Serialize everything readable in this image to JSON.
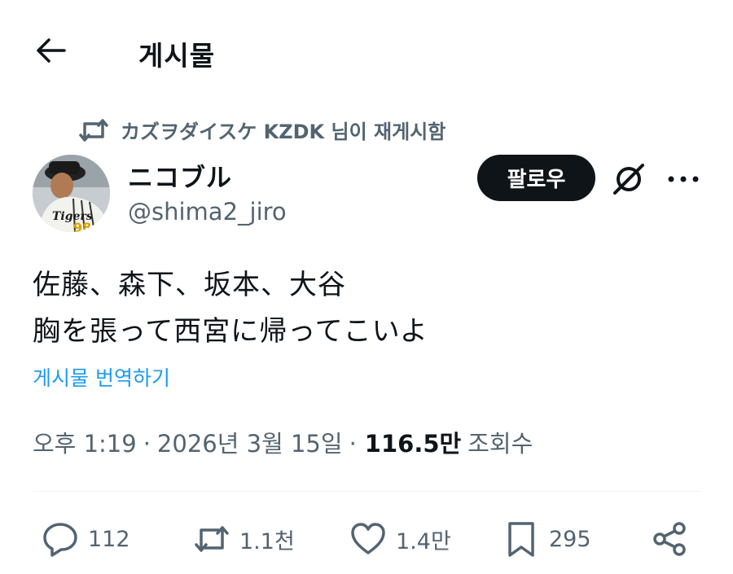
{
  "header": {
    "title": "게시물"
  },
  "repost": {
    "text": "カズヲダイスケ KZDK 님이 재게시함"
  },
  "author": {
    "display_name": "ニコブル",
    "handle": "@shima2_jiro",
    "avatar_text": "Tigers"
  },
  "follow": {
    "label": "팔로우"
  },
  "post": {
    "lines": [
      "佐藤、森下、坂本、大谷",
      "胸を張って西宮に帰ってこいよ"
    ],
    "translate_label": "게시물 번역하기"
  },
  "meta": {
    "time": "오후 1:19",
    "separator": "·",
    "date": "2026년 3월 15일",
    "views": "116.5만",
    "views_label": "조회수"
  },
  "actions": {
    "replies": "112",
    "reposts": "1.1천",
    "likes": "1.4만",
    "bookmarks": "295"
  },
  "icons": [
    "back-arrow-icon",
    "repost-icon",
    "grok-icon",
    "more-icon",
    "reply-icon",
    "like-icon",
    "bookmark-icon",
    "share-icon"
  ],
  "colors": {
    "text": "#0f1419",
    "secondary": "#536471",
    "link": "#1d9bf0",
    "button": "#0f1419"
  }
}
